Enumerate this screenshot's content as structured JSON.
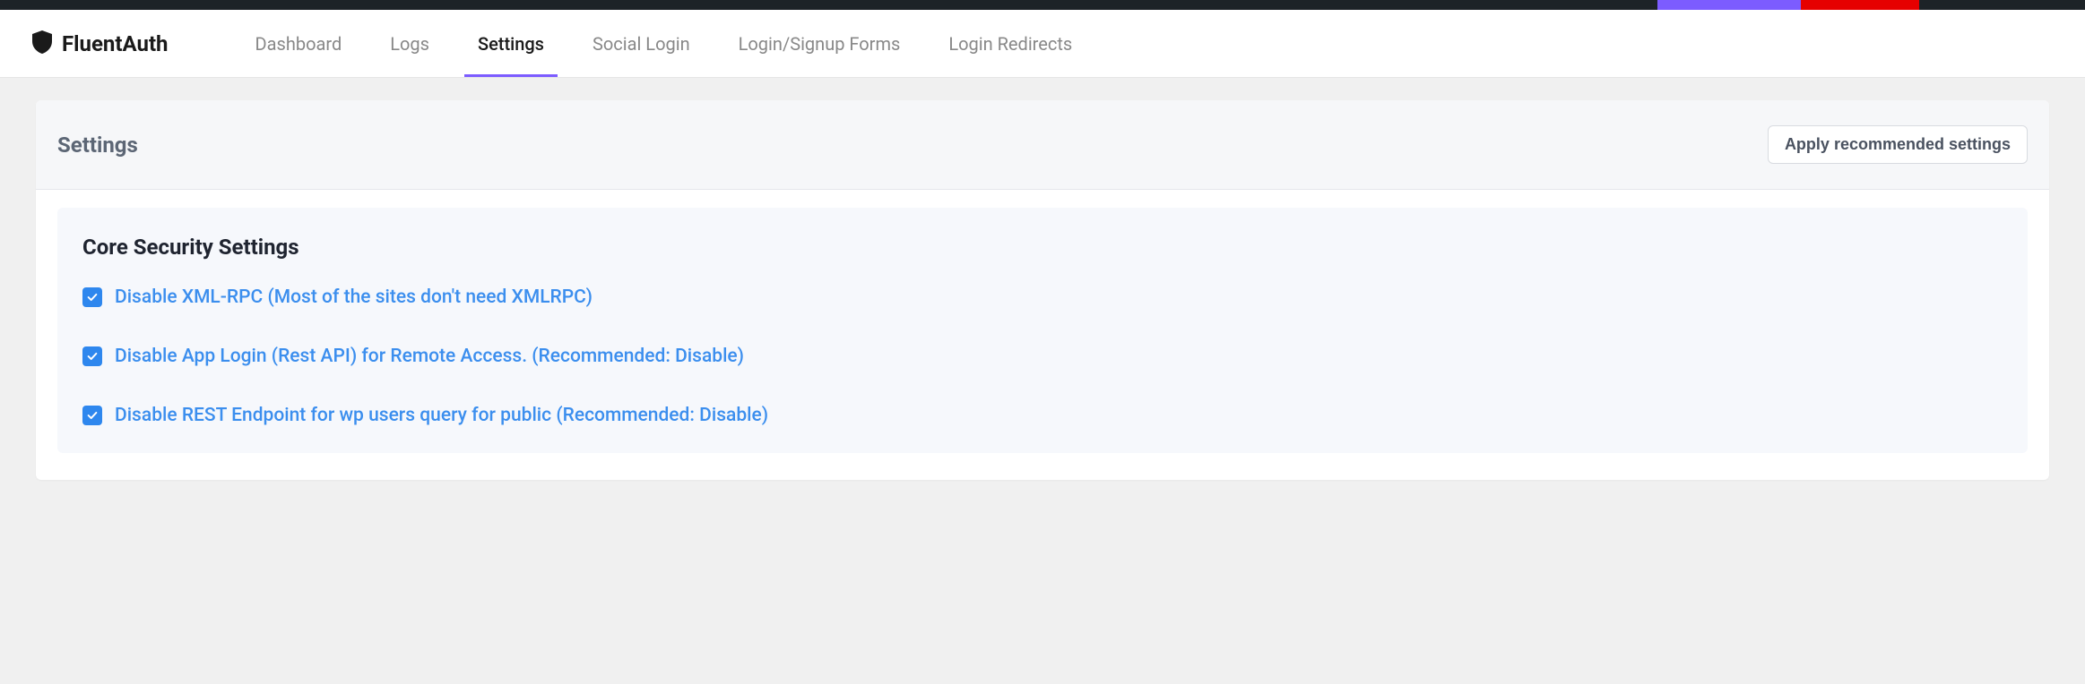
{
  "brand": {
    "name": "FluentAuth"
  },
  "nav": {
    "items": [
      {
        "label": "Dashboard",
        "active": false
      },
      {
        "label": "Logs",
        "active": false
      },
      {
        "label": "Settings",
        "active": true
      },
      {
        "label": "Social Login",
        "active": false
      },
      {
        "label": "Login/Signup Forms",
        "active": false
      },
      {
        "label": "Login Redirects",
        "active": false
      }
    ]
  },
  "settings": {
    "title": "Settings",
    "recommend_button": "Apply recommended settings",
    "section": {
      "title": "Core Security Settings",
      "options": [
        {
          "label": "Disable XML-RPC (Most of the sites don't need XMLRPC)",
          "checked": true
        },
        {
          "label": "Disable App Login (Rest API) for Remote Access. (Recommended: Disable)",
          "checked": true
        },
        {
          "label": "Disable REST Endpoint for wp users query for public (Recommended: Disable)",
          "checked": true
        }
      ]
    }
  }
}
